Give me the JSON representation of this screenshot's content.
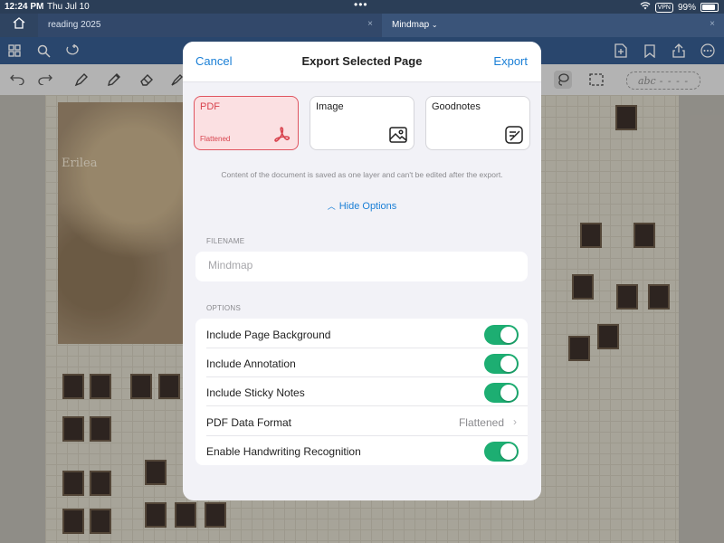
{
  "status_bar": {
    "time": "12:24 PM",
    "date": "Thu Jul 10",
    "vpn": "VPN",
    "battery": "99%"
  },
  "tabs": [
    {
      "label": "reading 2025",
      "close": "×"
    },
    {
      "label": "Mindmap",
      "close": "×"
    }
  ],
  "canvas": {
    "map_label": "Erilea"
  },
  "pen_toolbar": {
    "text_tool_label": "abc"
  },
  "modal": {
    "cancel_label": "Cancel",
    "title": "Export Selected Page",
    "export_label": "Export",
    "formats": [
      {
        "name": "PDF",
        "sub": "Flattened",
        "selected": true
      },
      {
        "name": "Image"
      },
      {
        "name": "Goodnotes"
      }
    ],
    "description": "Content of the document is saved as one layer and can't be edited after the export.",
    "hide_options_label": "Hide Options",
    "filename_section": "FILENAME",
    "filename_placeholder": "Mindmap",
    "options_section": "OPTIONS",
    "options": [
      {
        "label": "Include Page Background",
        "on": true
      },
      {
        "label": "Include Annotation",
        "on": true
      },
      {
        "label": "Include Sticky Notes",
        "on": true
      },
      {
        "label": "PDF Data Format",
        "value": "Flattened"
      },
      {
        "label": "Enable Handwriting Recognition",
        "on": true
      }
    ]
  },
  "colors": {
    "accent": "#1a7fd6",
    "toggle_on": "#1dae72",
    "pdf_red": "#d8434e",
    "toolbar_blue": "#355a8c"
  }
}
